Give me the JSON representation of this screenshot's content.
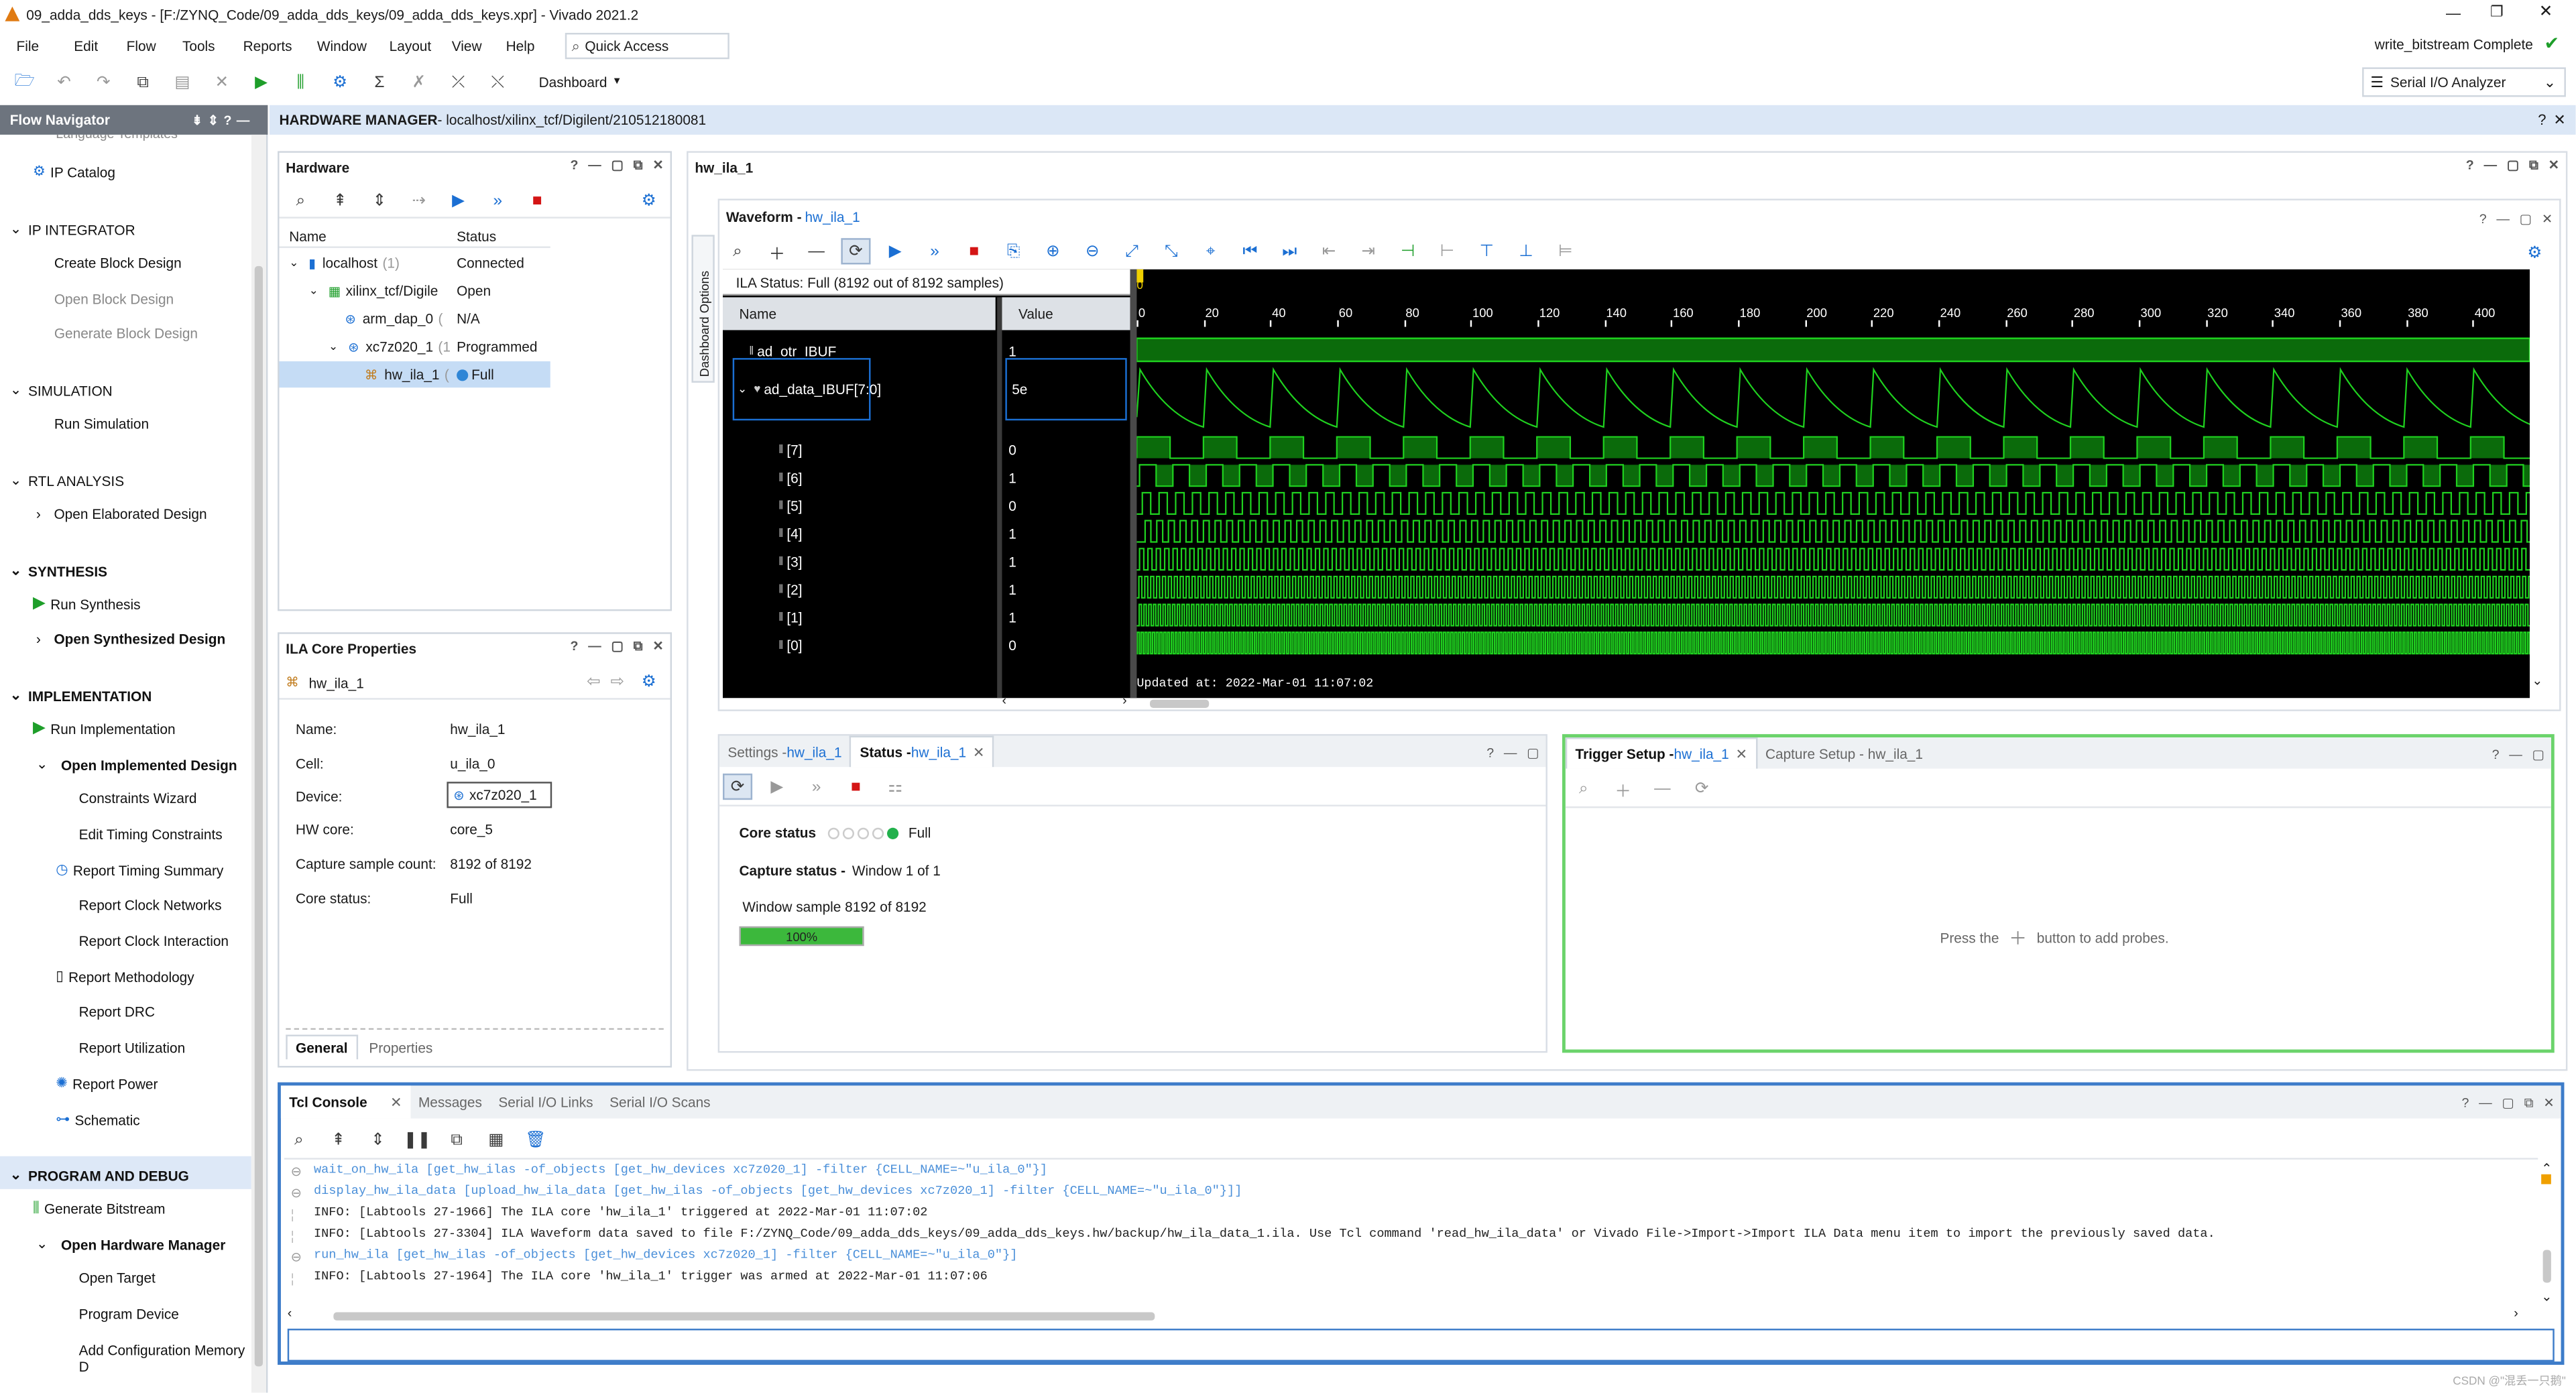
{
  "window": {
    "title": "09_adda_dds_keys - [F:/ZYNQ_Code/09_adda_dds_keys/09_adda_dds_keys.xpr] - Vivado 2021.2",
    "status": "write_bitstream Complete"
  },
  "menu": [
    "File",
    "Edit",
    "Flow",
    "Tools",
    "Reports",
    "Window",
    "Layout",
    "View",
    "Help"
  ],
  "quick_access": "Quick Access",
  "toolbar": {
    "dashboard": "Dashboard",
    "layout_select": "Serial I/O Analyzer"
  },
  "flow_nav": {
    "title": "Flow Navigator",
    "partial": "Language Templates",
    "ip_catalog": "IP Catalog",
    "sections": {
      "ip_integrator": "IP INTEGRATOR",
      "simulation": "SIMULATION",
      "rtl": "RTL ANALYSIS",
      "synthesis": "SYNTHESIS",
      "implementation": "IMPLEMENTATION",
      "program": "PROGRAM AND DEBUG"
    },
    "items": {
      "create_bd": "Create Block Design",
      "open_bd": "Open Block Design",
      "gen_bd": "Generate Block Design",
      "run_sim": "Run Simulation",
      "open_elab": "Open Elaborated Design",
      "run_synth": "Run Synthesis",
      "open_synth": "Open Synthesized Design",
      "run_impl": "Run Implementation",
      "open_impl": "Open Implemented Design",
      "constraints": "Constraints Wizard",
      "edit_timing": "Edit Timing Constraints",
      "rpt_timing": "Report Timing Summary",
      "rpt_clock_net": "Report Clock Networks",
      "rpt_clock_int": "Report Clock Interaction",
      "rpt_method": "Report Methodology",
      "rpt_drc": "Report DRC",
      "rpt_util": "Report Utilization",
      "rpt_power": "Report Power",
      "schematic": "Schematic",
      "gen_bit": "Generate Bitstream",
      "open_hw": "Open Hardware Manager",
      "open_target": "Open Target",
      "prog_dev": "Program Device",
      "add_cfg": "Add Configuration Memory D"
    }
  },
  "hw_manager": {
    "title": "HARDWARE MANAGER",
    "path": " - localhost/xilinx_tcf/Digilent/210512180081"
  },
  "hardware": {
    "title": "Hardware",
    "col_name": "Name",
    "col_status": "Status",
    "rows": [
      {
        "name": "localhost",
        "count": "(1)",
        "status": "Connected"
      },
      {
        "name": "xilinx_tcf/Digile",
        "status": "Open"
      },
      {
        "name": "arm_dap_0",
        "extra": "(",
        "status": "N/A"
      },
      {
        "name": "xc7z020_1",
        "extra": "(1",
        "status": "Programmed"
      },
      {
        "name": "hw_ila_1",
        "extra": "(",
        "status": "Full"
      }
    ]
  },
  "ila_props": {
    "title": "ILA Core Properties",
    "name_tag": "hw_ila_1",
    "labels": {
      "name": "Name:",
      "cell": "Cell:",
      "device": "Device:",
      "hwcore": "HW core:",
      "capture": "Capture sample count:",
      "core_status": "Core status:"
    },
    "values": {
      "name": "hw_ila_1",
      "cell": "u_ila_0",
      "device": "xc7z020_1",
      "hwcore": "core_5",
      "capture": "8192 of 8192",
      "core_status": "Full"
    },
    "tabs": [
      "General",
      "Properties"
    ]
  },
  "hw_ila_tab": "hw_ila_1",
  "waveform": {
    "title": "Waveform - ",
    "link": "hw_ila_1",
    "side_tab": "Dashboard Options",
    "ila_status": "ILA Status:  Full (8192 out of 8192 samples)",
    "col_name": "Name",
    "col_value": "Value",
    "signals": [
      {
        "name": "ad_otr_IBUF",
        "value": "1"
      },
      {
        "name": "ad_data_IBUF[7:0]",
        "value": "5e"
      },
      {
        "name": "[7]",
        "value": "0"
      },
      {
        "name": "[6]",
        "value": "1"
      },
      {
        "name": "[5]",
        "value": "0"
      },
      {
        "name": "[4]",
        "value": "1"
      },
      {
        "name": "[3]",
        "value": "1"
      },
      {
        "name": "[2]",
        "value": "1"
      },
      {
        "name": "[1]",
        "value": "1"
      },
      {
        "name": "[0]",
        "value": "0"
      }
    ],
    "ticks": [
      "0",
      "20",
      "40",
      "60",
      "80",
      "100",
      "120",
      "140",
      "160",
      "180",
      "200",
      "220",
      "240",
      "260",
      "280",
      "300",
      "320",
      "340",
      "360",
      "380",
      "400"
    ],
    "marker": "0",
    "updated": "Updated at: 2022-Mar-01 11:07:02"
  },
  "status_panel": {
    "tab_settings": "Settings - ",
    "tab_settings_link": "hw_ila_1",
    "tab_status": "Status - ",
    "tab_status_link": "hw_ila_1",
    "core_status_label": "Core status",
    "core_status_value": "Full",
    "capture_label": "Capture status - ",
    "capture_value": "Window 1 of 1",
    "window_sample": "Window sample 8192 of 8192",
    "progress": 100,
    "progress_text": "100%"
  },
  "trigger": {
    "tab_trigger": "Trigger Setup - ",
    "tab_trigger_link": "hw_ila_1",
    "tab_capture": "Capture Setup - hw_ila_1",
    "hint_pre": "Press the",
    "hint_post": "button to add probes."
  },
  "console": {
    "tabs": [
      "Tcl Console",
      "Messages",
      "Serial I/O Links",
      "Serial I/O Scans"
    ],
    "lines": [
      {
        "text": "wait_on_hw_ila [get_hw_ilas -of_objects [get_hw_devices xc7z020_1] -filter {CELL_NAME=~\"u_ila_0\"}]",
        "kind": "cmd"
      },
      {
        "text": "display_hw_ila_data [upload_hw_ila_data [get_hw_ilas -of_objects [get_hw_devices xc7z020_1] -filter {CELL_NAME=~\"u_ila_0\"}]]",
        "kind": "cmd"
      },
      {
        "text": "INFO: [Labtools 27-1966] The ILA core 'hw_ila_1' triggered at 2022-Mar-01 11:07:02",
        "kind": "info"
      },
      {
        "text": "INFO: [Labtools 27-3304] ILA Waveform data saved to file F:/ZYNQ_Code/09_adda_dds_keys/09_adda_dds_keys.hw/backup/hw_ila_data_1.ila. Use Tcl command 'read_hw_ila_data' or Vivado File->Import->Import ILA Data menu item to import the previously saved data.",
        "kind": "info"
      },
      {
        "text": "run_hw_ila [get_hw_ilas -of_objects [get_hw_devices xc7z020_1] -filter {CELL_NAME=~\"u_ila_0\"}]",
        "kind": "cmd"
      },
      {
        "text": "INFO: [Labtools 27-1964] The ILA core 'hw_ila_1' trigger was armed at 2022-Mar-01 11:07:06",
        "kind": "info"
      }
    ]
  },
  "watermark": "CSDN @\"混丢一只鹅\"",
  "colors": {
    "accent": "#1b6fd3",
    "wave": "#1fd21f",
    "wave_bg": "#000000",
    "trigger_border": "#6bd36b"
  }
}
